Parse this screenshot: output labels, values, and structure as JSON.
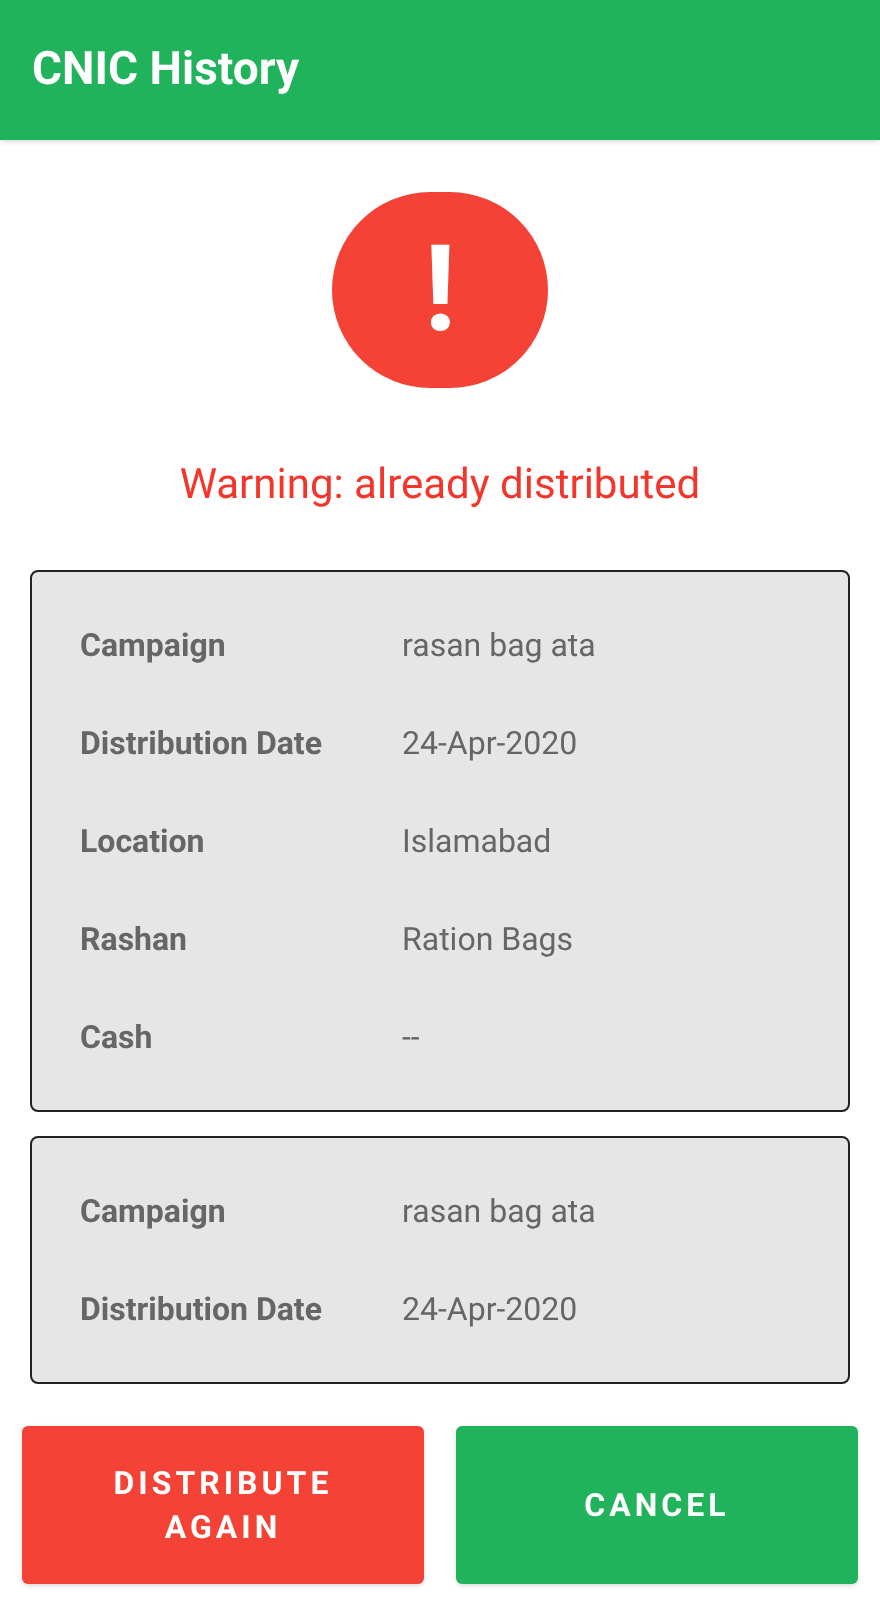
{
  "app_bar": {
    "title": "CNIC History"
  },
  "warning": {
    "icon": "!",
    "message": "Warning: already distributed"
  },
  "records": [
    {
      "fields": [
        {
          "label": "Campaign",
          "value": "rasan bag ata"
        },
        {
          "label": "Distribution Date",
          "value": "24-Apr-2020"
        },
        {
          "label": "Location",
          "value": "Islamabad"
        },
        {
          "label": "Rashan",
          "value": "Ration Bags"
        },
        {
          "label": "Cash",
          "value": "--"
        }
      ]
    },
    {
      "fields": [
        {
          "label": "Campaign",
          "value": "rasan bag ata"
        },
        {
          "label": "Distribution Date",
          "value": "24-Apr-2020"
        }
      ]
    }
  ],
  "buttons": [
    {
      "label": "DISTRIBUTE AGAIN",
      "kind": "danger"
    },
    {
      "label": "CANCEL",
      "kind": "primary"
    }
  ]
}
